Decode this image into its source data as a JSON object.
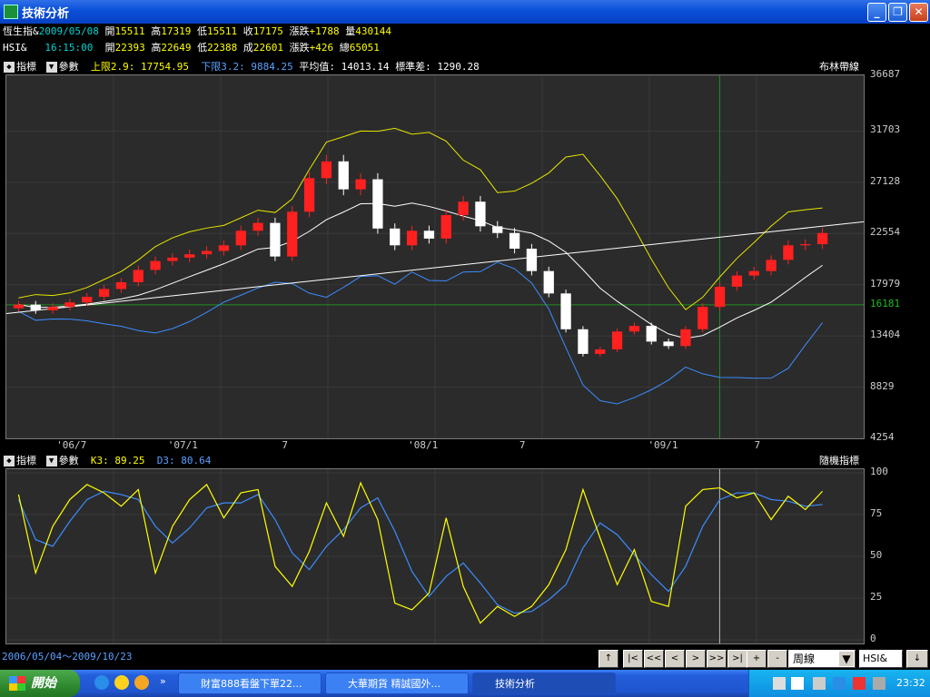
{
  "window": {
    "title": "技術分析",
    "minimize": "_",
    "maximize": "❐",
    "close": "✕"
  },
  "info1": {
    "name": "恆生指&",
    "date": "2009/05/08",
    "open_l": "開",
    "open": "15511",
    "high_l": "高",
    "high": "17319",
    "low_l": "低",
    "low": "15511",
    "close_l": "收",
    "close": "17175",
    "chg_l": "漲跌",
    "chg": "+1788",
    "vol_l": "量",
    "vol": "430144"
  },
  "info2": {
    "name": "HSI&",
    "time": "16:15:00",
    "open_l": "開",
    "open": "22393",
    "high_l": "高",
    "high": "22649",
    "low_l": "低",
    "low": "22388",
    "close_l": "成",
    "close": "22601",
    "chg_l": "漲跌",
    "chg": "+426",
    "tot_l": "總",
    "tot": "65051"
  },
  "main_header": {
    "btn1": "指標",
    "btn2": "參數",
    "upper": "上限2.9: 17754.95",
    "lower": "下限3.2: 9884.25",
    "avg": "平均值: 14013.14",
    "std": "標準差: 1290.28",
    "name": "布林帶線"
  },
  "sub_header": {
    "btn1": "指標",
    "btn2": "參數",
    "k": "K3: 89.25",
    "d": "D3: 80.64",
    "name": "隨機指標"
  },
  "main_yticks": [
    "36687",
    "31703",
    "27128",
    "22554",
    "17979",
    "16181",
    "13404",
    "8829",
    "4254"
  ],
  "main_xticks": [
    "'06/7",
    "'07/1",
    "7",
    "'08/1",
    "7",
    "'09/1",
    "7"
  ],
  "sub_yticks": [
    "100",
    "75",
    "50",
    "25",
    "0"
  ],
  "range": "2006/05/04～2009/10/23",
  "nav": {
    "up": "↑",
    "first": "|<",
    "fastback": "<<",
    "back": "<",
    "fwd": ">",
    "fastfwd": ">>",
    "last": ">|",
    "plus": "+",
    "minus": "-",
    "period": "周線",
    "symbol": "HSI&"
  },
  "taskbar": {
    "start": "開始",
    "task1": "財富888看盤下單22...",
    "task2": "大華期貨 精誠國外...",
    "task3": "技術分析",
    "clock": "23:32"
  },
  "colors": {
    "up": "#ff2020",
    "down": "#ffffff",
    "boll_upper": "#e6e600",
    "boll_mid": "#ffffff",
    "boll_lower": "#3c8cff",
    "k": "#ffff00",
    "d": "#3c8cff"
  },
  "chart_data": [
    {
      "type": "candlestick",
      "title": "布林帶線",
      "ylim": [
        4254,
        36687
      ],
      "yticks": [
        36687,
        31703,
        27128,
        22554,
        17979,
        13404,
        8829,
        4254
      ],
      "hline": 16181,
      "series": [
        {
          "name": "close",
          "values": [
            16200,
            15700,
            16000,
            16400,
            16900,
            17600,
            18200,
            19300,
            20100,
            20400,
            20700,
            21000,
            21500,
            22800,
            23500,
            20500,
            24500,
            27500,
            29000,
            26500,
            27400,
            23000,
            21500,
            22800,
            22100,
            24200,
            25400,
            23200,
            22600,
            21200,
            19200,
            17200,
            14000,
            11800,
            12200,
            13800,
            14300,
            12900,
            12500,
            14000,
            16000,
            17800,
            18800,
            19200,
            20200,
            21500,
            21600,
            22600
          ]
        }
      ]
    },
    {
      "type": "line",
      "title": "隨機指標",
      "ylim": [
        0,
        100
      ],
      "yticks": [
        100,
        75,
        50,
        25,
        0
      ],
      "series": [
        {
          "name": "K3",
          "values": [
            87,
            40,
            68,
            84,
            93,
            88,
            80,
            90,
            40,
            68,
            84,
            93,
            73,
            88,
            90,
            44,
            32,
            53,
            82,
            62,
            94,
            72,
            22,
            18,
            28,
            73,
            32,
            10,
            20,
            14,
            20,
            33,
            54,
            90,
            61,
            33,
            54,
            23,
            20,
            80,
            90,
            91,
            85,
            88,
            72,
            86,
            78,
            89
          ]
        },
        {
          "name": "D3",
          "values": [
            84,
            60,
            56,
            71,
            84,
            89,
            87,
            84,
            68,
            58,
            67,
            79,
            82,
            82,
            87,
            72,
            52,
            42,
            56,
            66,
            79,
            85,
            65,
            41,
            26,
            38,
            46,
            34,
            21,
            16,
            17,
            24,
            33,
            55,
            70,
            63,
            51,
            39,
            29,
            44,
            68,
            84,
            88,
            88,
            84,
            83,
            80,
            81
          ]
        }
      ]
    }
  ]
}
